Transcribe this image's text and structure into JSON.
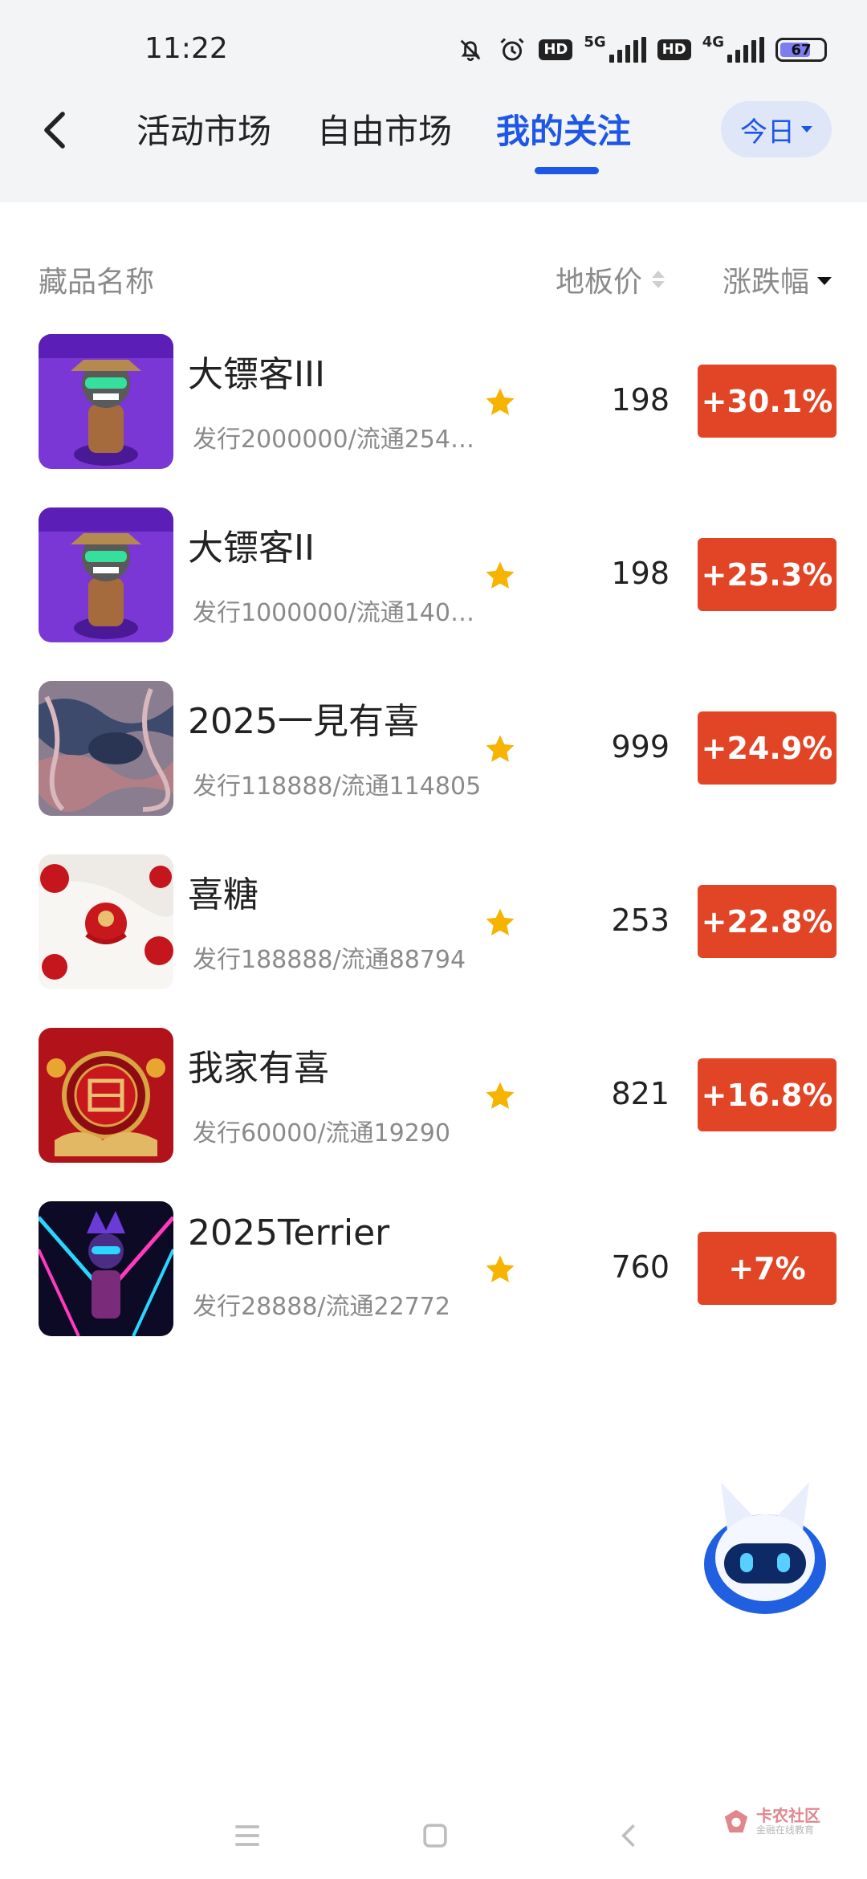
{
  "status_bar": {
    "time": "11:22",
    "icons": [
      "bell-off-icon",
      "alarm-icon",
      "hd-icon",
      "5g-signal-icon",
      "hd-icon",
      "4g-signal-icon",
      "battery-icon"
    ],
    "net1": "5G",
    "net2": "4G",
    "hd": "HD",
    "battery": "67"
  },
  "header": {
    "tabs": [
      {
        "label": "活动市场"
      },
      {
        "label": "自由市场"
      },
      {
        "label": "我的关注"
      }
    ],
    "active_tab": "我的关注",
    "period_label": "今日"
  },
  "columns": {
    "name": "藏品名称",
    "floor_price": "地板价",
    "change": "涨跌幅"
  },
  "items": [
    {
      "title": "大镖客III",
      "subtitle": "发行2000000/流通254…",
      "price": "198",
      "change": "+30.1%",
      "thumb": "purple-cowboy-art"
    },
    {
      "title": "大镖客II",
      "subtitle": "发行1000000/流通140…",
      "price": "198",
      "change": "+25.3%",
      "thumb": "purple-cowboy-art"
    },
    {
      "title": "2025一見有喜",
      "subtitle": "发行118888/流通114805",
      "price": "999",
      "change": "+24.9%",
      "thumb": "abstract-pattern"
    },
    {
      "title": "喜糖",
      "subtitle": "发行188888/流通88794",
      "price": "253",
      "change": "+22.8%",
      "thumb": "red-candy"
    },
    {
      "title": "我家有喜",
      "subtitle": "发行60000/流通19290",
      "price": "821",
      "change": "+16.8%",
      "thumb": "red-double-happiness"
    },
    {
      "title": "2025Terrier",
      "subtitle": "发行28888/流通22772",
      "price": "760",
      "change": "+7%",
      "thumb": "neon-terrier"
    }
  ],
  "watermark": {
    "text": "卡农社区",
    "sub": "金融在线教育"
  },
  "colors": {
    "accent": "#1e57e6",
    "gain": "#e24426",
    "star": "#f6b400"
  }
}
